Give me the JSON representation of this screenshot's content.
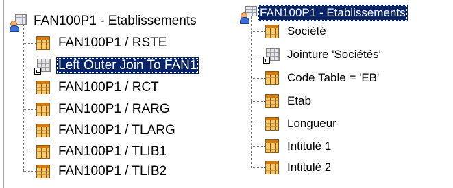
{
  "left_tree": {
    "root": {
      "label": "FAN100P1 - Etablissements",
      "icon": "entity-icon"
    },
    "children": [
      {
        "label": "FAN100P1 / RSTE",
        "icon": "table-icon"
      },
      {
        "label": "Left Outer Join To FAN1",
        "icon": "join-icon",
        "selected": true
      },
      {
        "label": "FAN100P1 / RCT",
        "icon": "table-icon"
      },
      {
        "label": "FAN100P1 / RARG",
        "icon": "table-icon"
      },
      {
        "label": "FAN100P1 / TLARG",
        "icon": "table-icon"
      },
      {
        "label": "FAN100P1 / TLIB1",
        "icon": "table-icon"
      },
      {
        "label": "FAN100P1 / TLIB2",
        "icon": "table-icon"
      }
    ]
  },
  "right_tree": {
    "root": {
      "label": "FAN100P1 - Etablissements",
      "icon": "entity-icon",
      "selected": true
    },
    "children": [
      {
        "label": "Société",
        "icon": "table-icon"
      },
      {
        "label": "Jointure 'Sociétés'",
        "icon": "join-icon"
      },
      {
        "label": "Code Table = 'EB'",
        "icon": "table-icon"
      },
      {
        "label": "Etab",
        "icon": "table-icon"
      },
      {
        "label": "Longueur",
        "icon": "table-icon"
      },
      {
        "label": "Intitulé 1",
        "icon": "table-icon"
      },
      {
        "label": "Intitulé 2",
        "icon": "table-icon"
      }
    ]
  },
  "colors": {
    "selection": "#0a246a",
    "table_icon": "#f7c86a"
  }
}
